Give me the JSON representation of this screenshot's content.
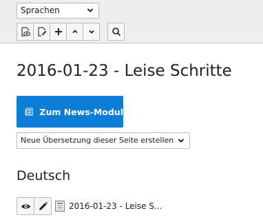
{
  "toolbar": {
    "language_select": {
      "value": "Sprachen"
    },
    "buttons": [
      {
        "icon": "view-page-icon"
      },
      {
        "icon": "edit-page-icon"
      },
      {
        "icon": "plus-icon"
      },
      {
        "icon": "chevron-up-icon"
      },
      {
        "icon": "chevron-down-icon"
      }
    ],
    "search_icon": "search-icon"
  },
  "main": {
    "title": "2016-01-23 - Leise Schritte",
    "news_button": {
      "label": "Zum News-Modul",
      "color": "#0b7fd5"
    },
    "translation_select": {
      "value": "Neue Übersetzung dieser Seite erstellen"
    },
    "section": {
      "heading": "Deutsch"
    },
    "record": {
      "title": "2016-01-23 - Leise S..."
    }
  },
  "colors": {
    "topbar_bg": "#eeeeee",
    "accent": "#0b7fd5"
  }
}
